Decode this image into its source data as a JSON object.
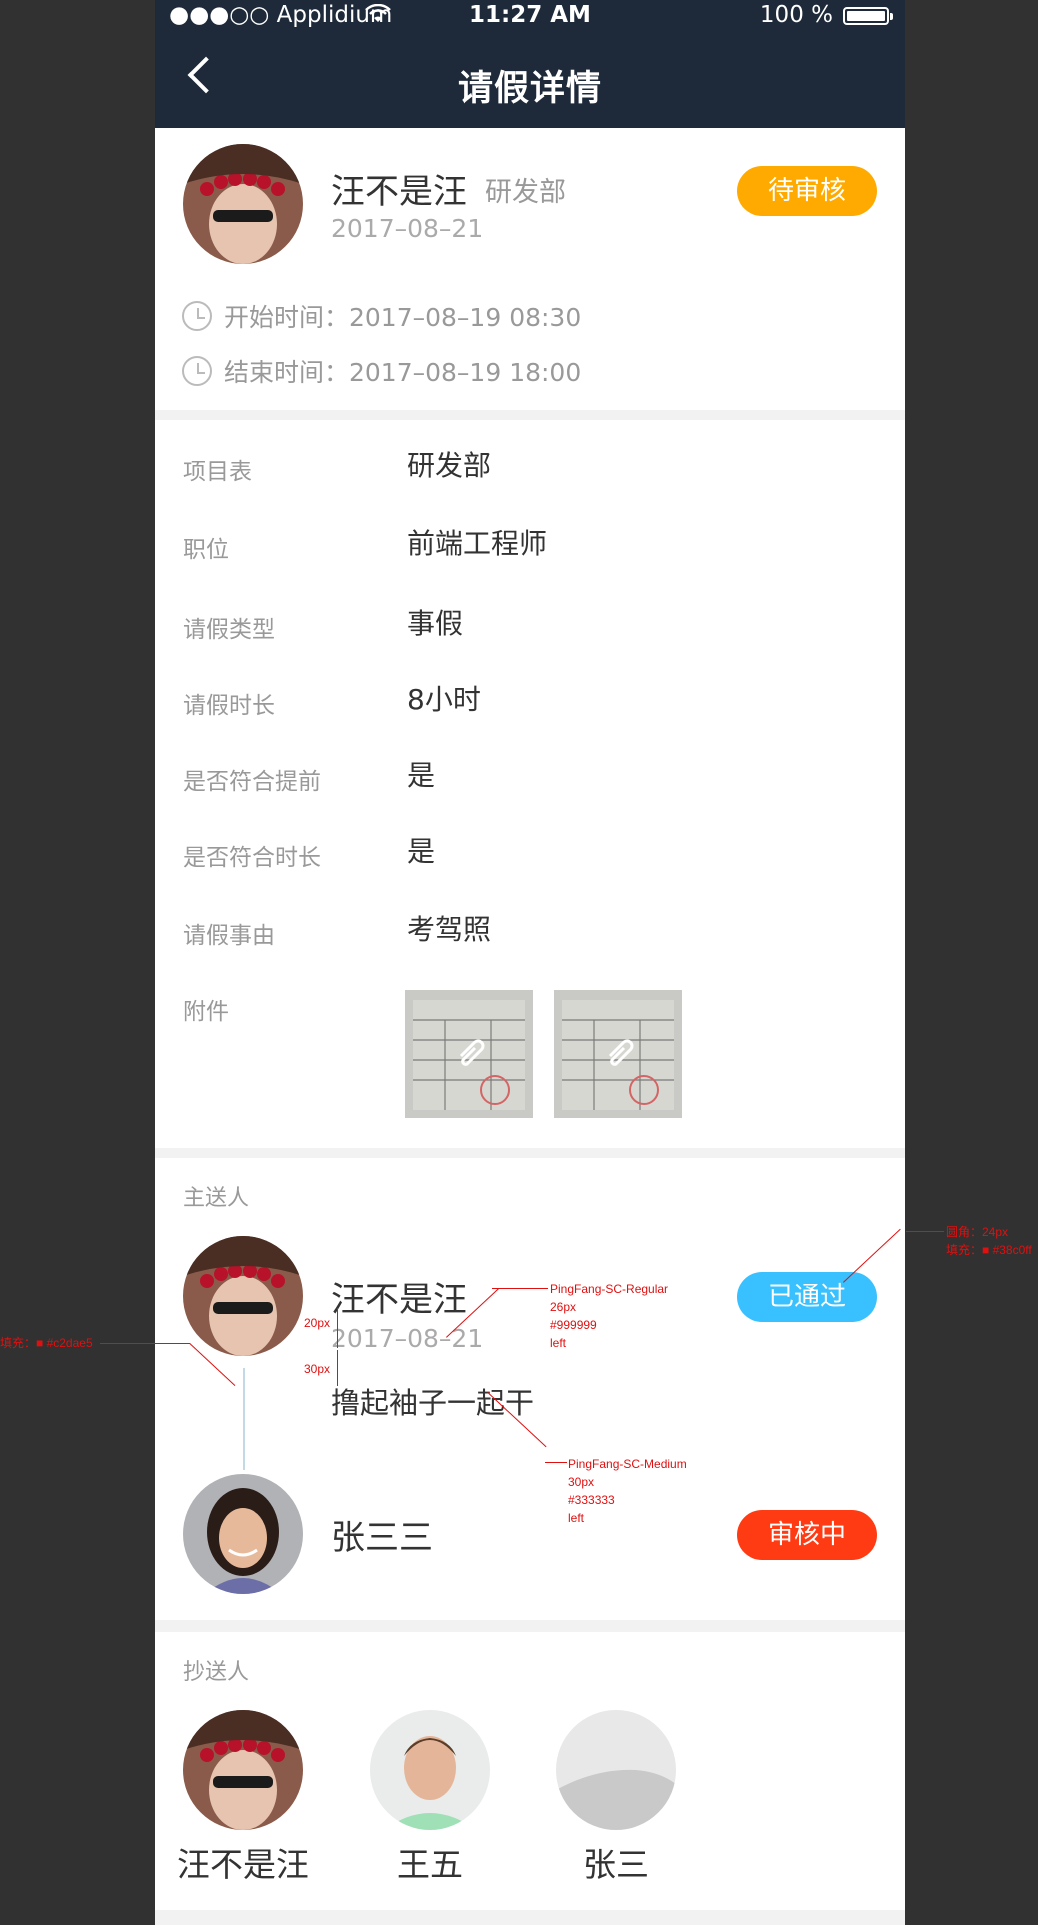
{
  "status_bar": {
    "carrier": "●●●○○ Applidium",
    "wifi": "wifi-icon",
    "time": "11:27 AM",
    "battery": "100 %"
  },
  "nav": {
    "title": "请假详情",
    "back_icon": "chevron-left-icon"
  },
  "applicant": {
    "name": "汪不是汪",
    "dept": "研发部",
    "date": "2017–08–21",
    "status": "待审核",
    "status_color": "#ffaa00",
    "start_time": "开始时间：2017–08–19  08:30",
    "end_time": "结束时间：2017–08–19  18:00"
  },
  "details": [
    {
      "label": "项目表",
      "value": "研发部"
    },
    {
      "label": "职位",
      "value": "前端工程师"
    },
    {
      "label": "请假类型",
      "value": "事假"
    },
    {
      "label": "请假时长",
      "value": "8小时"
    },
    {
      "label": "是否符合提前",
      "value": "是"
    },
    {
      "label": "是否符合时长",
      "value": "是"
    },
    {
      "label": "请假事由",
      "value": "考驾照"
    }
  ],
  "attachments": {
    "label": "附件",
    "items": [
      "attachment-1",
      "attachment-2"
    ]
  },
  "approvers": {
    "title": "主送人",
    "items": [
      {
        "name": "汪不是汪",
        "date": "2017–08–21",
        "comment": "撸起袖子一起干",
        "status": "已通过",
        "status_color": "#38c0ff"
      },
      {
        "name": "张三三",
        "status": "审核中",
        "status_color": "#ff3b14"
      }
    ],
    "line_color": "#c2dae5"
  },
  "cc": {
    "title": "抄送人",
    "items": [
      {
        "name": "汪不是汪"
      },
      {
        "name": "王五"
      },
      {
        "name": "张三"
      }
    ]
  },
  "annotations": {
    "date_font": [
      "PingFang-SC-Regular",
      "26px",
      "#999999",
      "left"
    ],
    "comment_font": [
      "PingFang-SC-Medium",
      "30px",
      "#333333",
      "left"
    ],
    "pill_radius": "圆角：24px",
    "pill_fill": "填充：■ #38c0ff",
    "line_fill": "填充：■ #c2dae5",
    "gap_20": "20px",
    "gap_30": "30px"
  }
}
